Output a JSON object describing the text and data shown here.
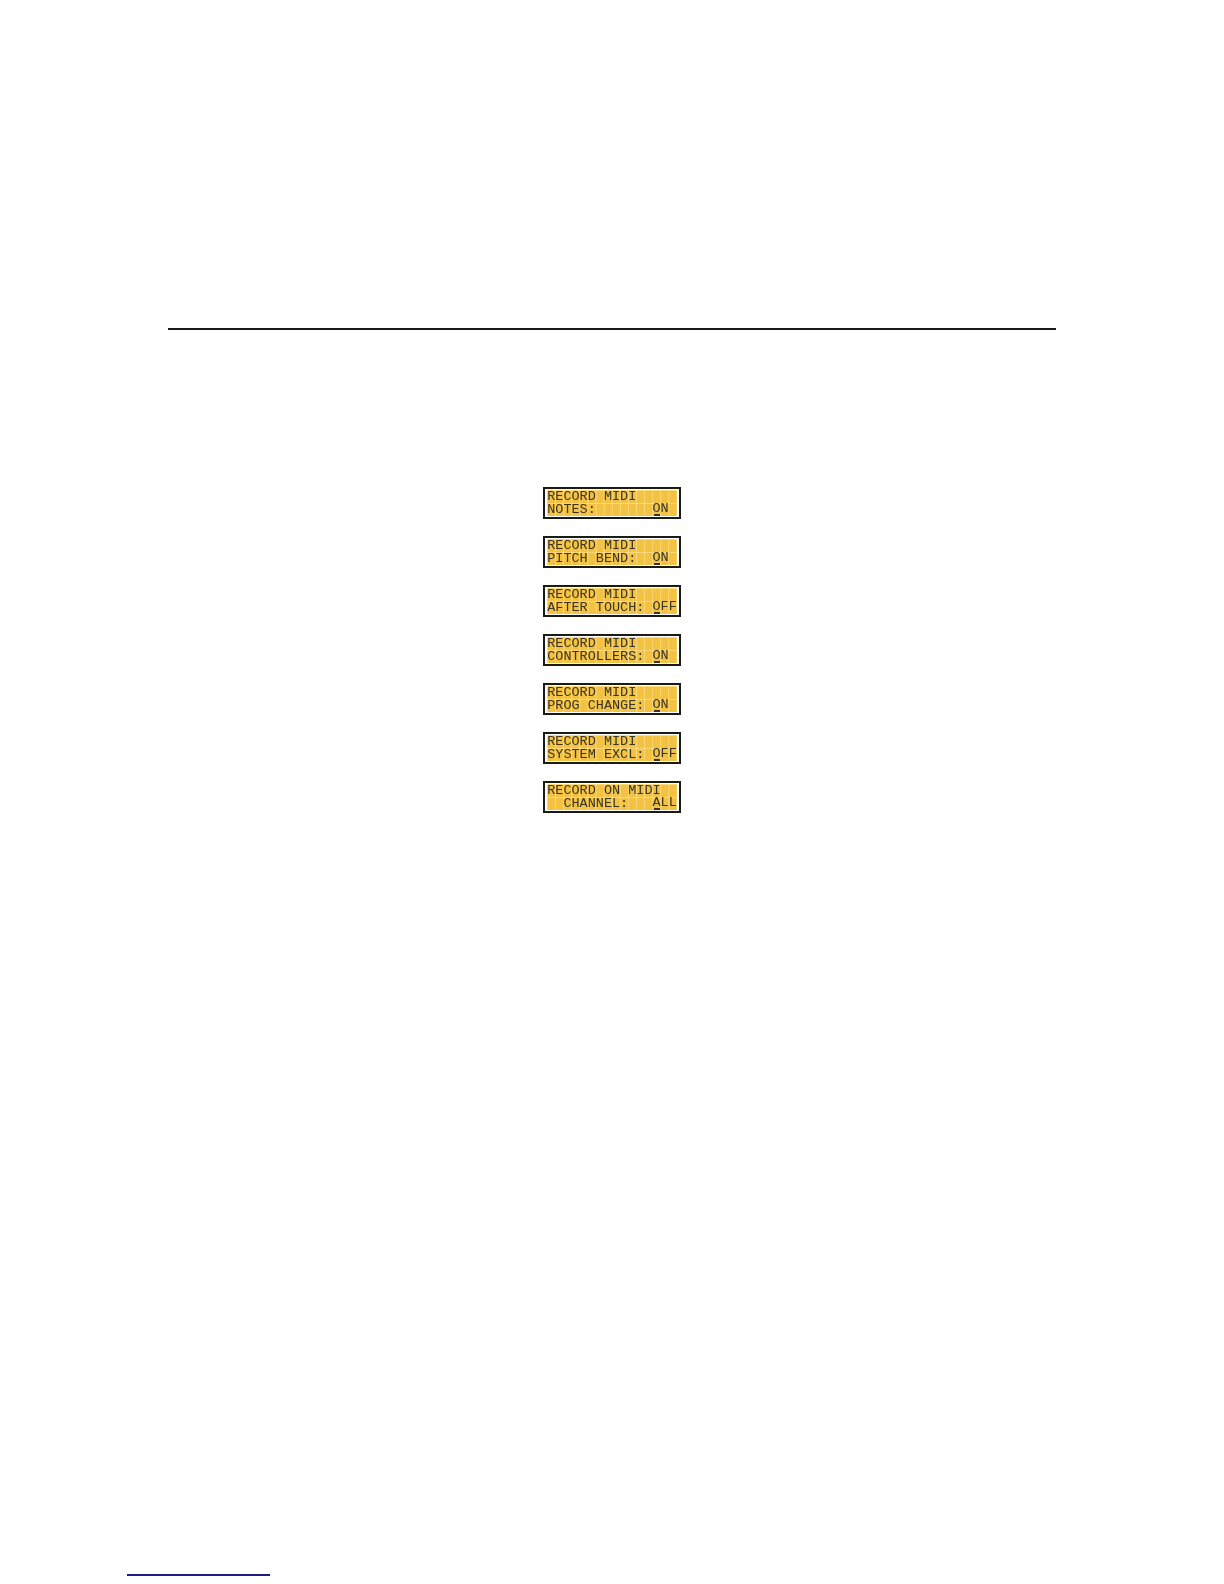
{
  "displays": [
    {
      "line_1": "RECORD MIDI",
      "label": "NOTES:",
      "value": "ON"
    },
    {
      "line_1": "RECORD MIDI",
      "label": "PITCH BEND:",
      "value": "ON"
    },
    {
      "line_1": "RECORD MIDI",
      "label": "AFTER TOUCH:",
      "value": "OFF"
    },
    {
      "line_1": "RECORD MIDI",
      "label": "CONTROLLERS:",
      "value": "ON"
    },
    {
      "line_1": "RECORD MIDI",
      "label": "PROG CHANGE:",
      "value": "ON"
    },
    {
      "line_1": "RECORD MIDI",
      "label": "SYSTEM EXCL:",
      "value": "OFF"
    },
    {
      "line_1": "RECORD ON MIDI",
      "label": "  CHANNEL:",
      "value": "ALL"
    }
  ]
}
